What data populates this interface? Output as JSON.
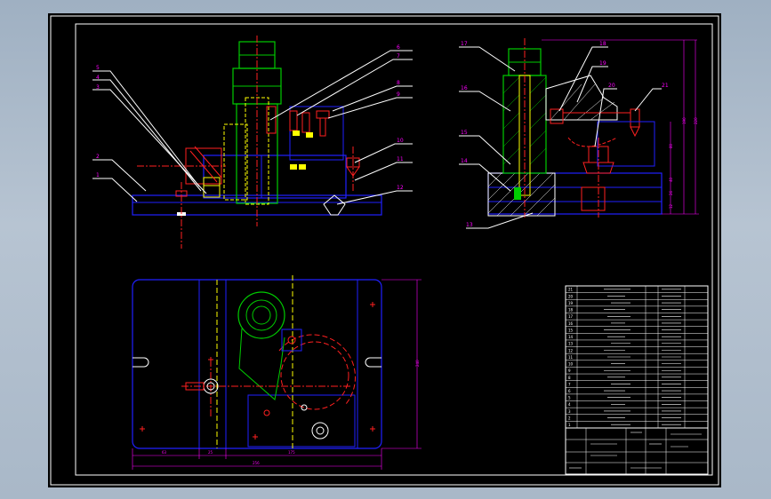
{
  "balloons_left": [
    "5",
    "4",
    "3",
    "2",
    "1",
    "6",
    "7",
    "8",
    "9",
    "10",
    "11",
    "12"
  ],
  "balloons_right": [
    "17",
    "16",
    "15",
    "14",
    "13",
    "18",
    "19",
    "20",
    "21"
  ],
  "dims_right": [
    "80",
    "190",
    "220",
    "40",
    "26",
    "12"
  ],
  "dims_plan": [
    "63",
    "25",
    "175",
    "256",
    "240"
  ],
  "parts_rows": [
    "21",
    "20",
    "19",
    "18",
    "17",
    "16",
    "15",
    "14",
    "13",
    "12",
    "11",
    "10",
    "9",
    "8",
    "7",
    "6",
    "5",
    "4",
    "3",
    "2",
    "1"
  ],
  "colors": {
    "outline": "#ffffff",
    "body": "#2020ff",
    "section": "#00cc00",
    "hidden": "#ffff00",
    "centerline": "#ff2020",
    "dimension": "#ff00ff",
    "leader": "#ffffff"
  }
}
